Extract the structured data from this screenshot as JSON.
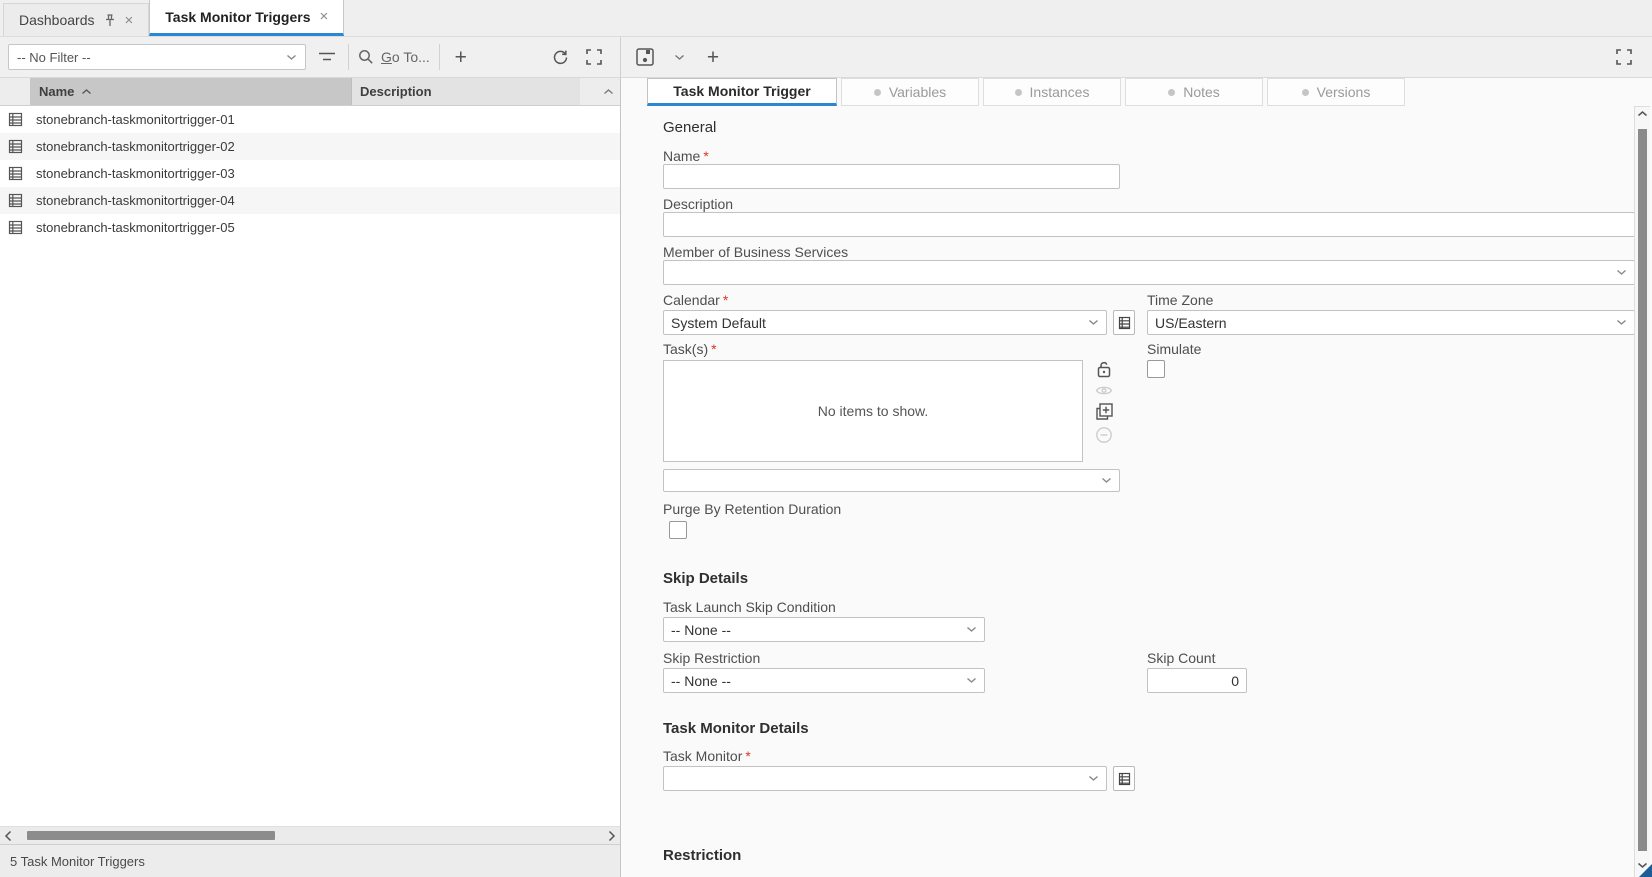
{
  "ui": {
    "required_marker": "*",
    "accent_color": "#2b86d3",
    "required_color": "#d9342b"
  },
  "icons": {
    "close": "×",
    "plus": "+",
    "pin": "pushpin",
    "filter": "filter-lines",
    "search": "magnifier",
    "refresh": "circular-arrows",
    "expand": "fullscreen-corners",
    "save": "floppy-disk",
    "chevron": "chevron-down",
    "sort": "chevron-up",
    "lock": "padlock-open",
    "eye": "eye",
    "add_window": "window-plus",
    "remove": "circle-minus",
    "record": "table-grid",
    "list_picker": "table-list"
  },
  "tabstrip": {
    "tabs": [
      {
        "label": "Dashboards",
        "pinned": true,
        "active": false
      },
      {
        "label": "Task Monitor Triggers",
        "pinned": false,
        "active": true
      }
    ]
  },
  "toolbar": {
    "filter_value": "-- No Filter --",
    "goto_g": "G",
    "goto_rest": "o To..."
  },
  "grid": {
    "columns": [
      {
        "label": "Name",
        "sorted": "ascending"
      },
      {
        "label": "Description",
        "sorted": ""
      }
    ],
    "rows": [
      {
        "name": "stonebranch-taskmonitortrigger-01",
        "description": ""
      },
      {
        "name": "stonebranch-taskmonitortrigger-02",
        "description": ""
      },
      {
        "name": "stonebranch-taskmonitortrigger-03",
        "description": ""
      },
      {
        "name": "stonebranch-taskmonitortrigger-04",
        "description": ""
      },
      {
        "name": "stonebranch-taskmonitortrigger-05",
        "description": ""
      }
    ],
    "status": "5 Task Monitor Triggers"
  },
  "detail": {
    "tabs": [
      {
        "label": "Task Monitor Trigger",
        "active": true
      },
      {
        "label": "Variables",
        "active": false
      },
      {
        "label": "Instances",
        "active": false
      },
      {
        "label": "Notes",
        "active": false
      },
      {
        "label": "Versions",
        "active": false
      }
    ],
    "form": {
      "general": {
        "heading": "General",
        "name_label": "Name",
        "name_value": "",
        "description_label": "Description",
        "description_value": "",
        "member_label": "Member of Business Services",
        "member_value": "",
        "calendar_label": "Calendar",
        "calendar_value": "System Default",
        "timezone_label": "Time Zone",
        "timezone_value": "US/Eastern",
        "tasks_label": "Task(s)",
        "tasks_empty": "No items to show.",
        "tasks_select_value": "",
        "simulate_label": "Simulate",
        "simulate_checked": false,
        "purge_label": "Purge By Retention Duration",
        "purge_checked": false
      },
      "skip": {
        "heading": "Skip Details",
        "tlsc_label": "Task Launch Skip Condition",
        "tlsc_value": "-- None --",
        "restriction_label": "Skip Restriction",
        "restriction_value": "-- None --",
        "count_label": "Skip Count",
        "count_value": "0"
      },
      "monitor": {
        "heading": "Task Monitor Details",
        "monitor_label": "Task Monitor",
        "monitor_value": ""
      },
      "next_section_partial": "Restriction"
    }
  }
}
